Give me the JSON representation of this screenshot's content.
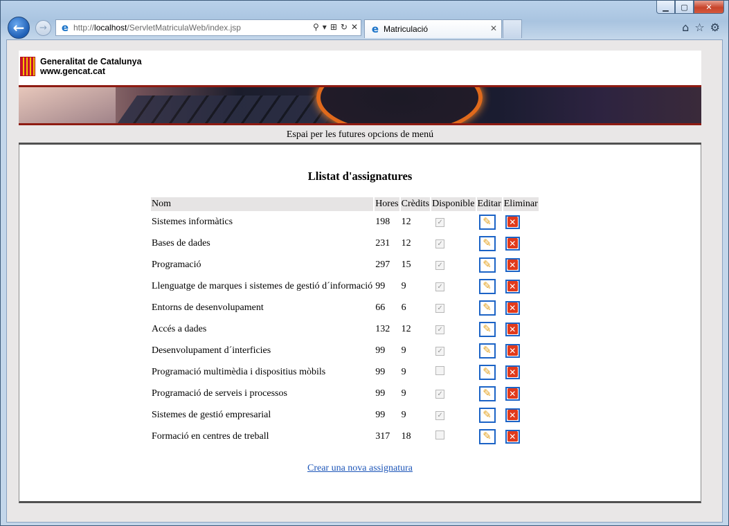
{
  "browser": {
    "url_prefix": "http://",
    "url_host": "localhost",
    "url_path": "/ServletMatriculaWeb/index.jsp",
    "tab_title": "Matriculació"
  },
  "header": {
    "org_name": "Generalitat de Catalunya",
    "org_site": "www.gencat.cat"
  },
  "menu": {
    "placeholder_text": "Espai per les futures opcions de menú"
  },
  "main": {
    "title": "Llistat d'assignatures",
    "columns": [
      "Nom",
      "Hores",
      "Crèdits",
      "Disponible",
      "Editar",
      "Eliminar"
    ],
    "rows": [
      {
        "nom": "Sistemes informàtics",
        "hores": "198",
        "credits": "12",
        "disponible": true
      },
      {
        "nom": "Bases de dades",
        "hores": "231",
        "credits": "12",
        "disponible": true
      },
      {
        "nom": "Programació",
        "hores": "297",
        "credits": "15",
        "disponible": true
      },
      {
        "nom": "Llenguatge de marques i sistemes de gestió d´informació",
        "hores": "99",
        "credits": "9",
        "disponible": true
      },
      {
        "nom": "Entorns de desenvolupament",
        "hores": "66",
        "credits": "6",
        "disponible": true
      },
      {
        "nom": "Accés a dades",
        "hores": "132",
        "credits": "12",
        "disponible": true
      },
      {
        "nom": "Desenvolupament d´interficies",
        "hores": "99",
        "credits": "9",
        "disponible": true
      },
      {
        "nom": "Programació multimèdia i dispositius mòbils",
        "hores": "99",
        "credits": "9",
        "disponible": false
      },
      {
        "nom": "Programació de serveis i processos",
        "hores": "99",
        "credits": "9",
        "disponible": true
      },
      {
        "nom": "Sistemes de gestió empresarial",
        "hores": "99",
        "credits": "9",
        "disponible": true
      },
      {
        "nom": "Formació en centres de treball",
        "hores": "317",
        "credits": "18",
        "disponible": false
      }
    ],
    "new_link": "Crear una nova assignatura"
  },
  "icons": {
    "edit": "pencil-icon",
    "delete": "delete-x-icon",
    "accent": "#1b63c6",
    "delete_color": "#e13a1c",
    "banner_border": "#8e1b12"
  }
}
